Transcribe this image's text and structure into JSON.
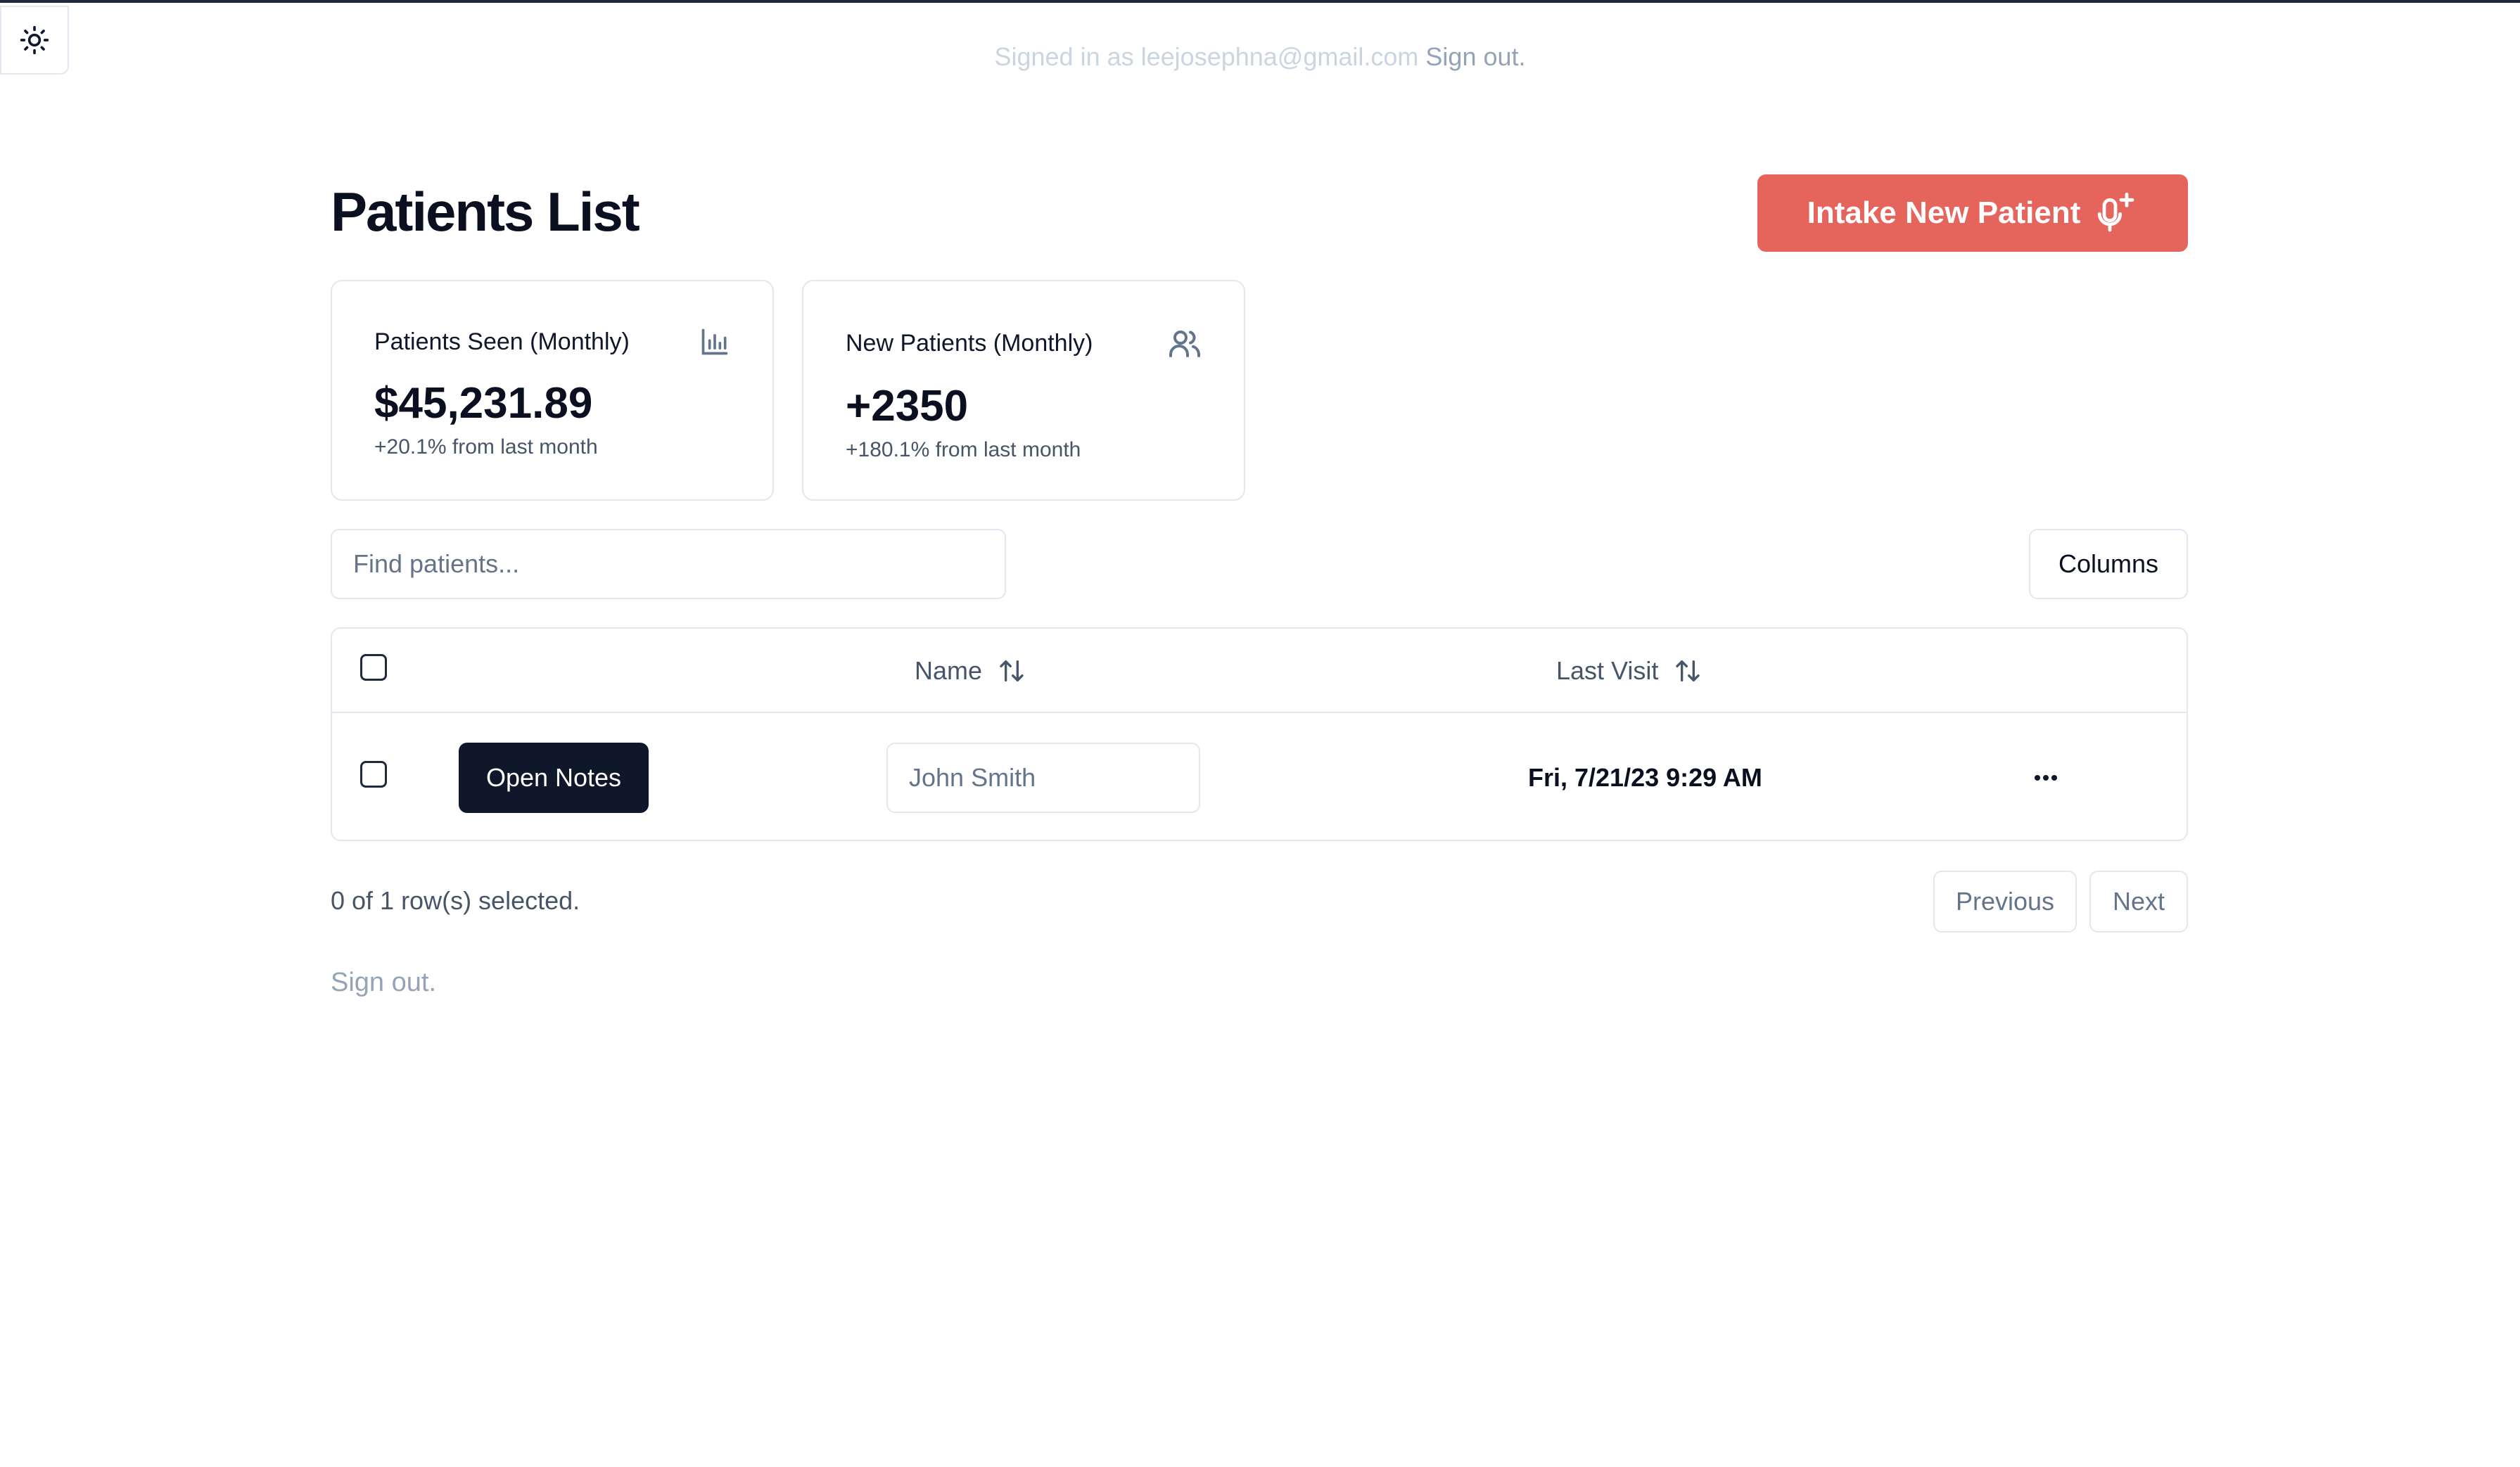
{
  "header": {
    "signed_in_text": "Signed in as leejosephna@gmail.com",
    "sign_out_link": "Sign out."
  },
  "page": {
    "title": "Patients List",
    "intake_button_label": "Intake New Patient",
    "intake_button_color": "#e5645b"
  },
  "stats": [
    {
      "title": "Patients Seen (Monthly)",
      "value": "$45,231.89",
      "subtitle": "+20.1% from last month",
      "icon": "bar-chart-icon"
    },
    {
      "title": "New Patients (Monthly)",
      "value": "+2350",
      "subtitle": "+180.1% from last month",
      "icon": "users-icon"
    }
  ],
  "search": {
    "placeholder": "Find patients...",
    "value": ""
  },
  "toolbar": {
    "columns_label": "Columns"
  },
  "table": {
    "columns": [
      {
        "label": "Name",
        "sort_icon": "sort-arrows-icon"
      },
      {
        "label": "Last Visit",
        "sort_icon": "sort-arrows-icon"
      }
    ],
    "rows": [
      {
        "action_label": "Open Notes",
        "name": "John Smith",
        "last_visit": "Fri, 7/21/23 9:29 AM",
        "menu_icon": "ellipsis-icon"
      }
    ]
  },
  "footer": {
    "selected_text": "0 of 1 row(s) selected.",
    "previous_label": "Previous",
    "next_label": "Next",
    "sign_out_label": "Sign out."
  }
}
